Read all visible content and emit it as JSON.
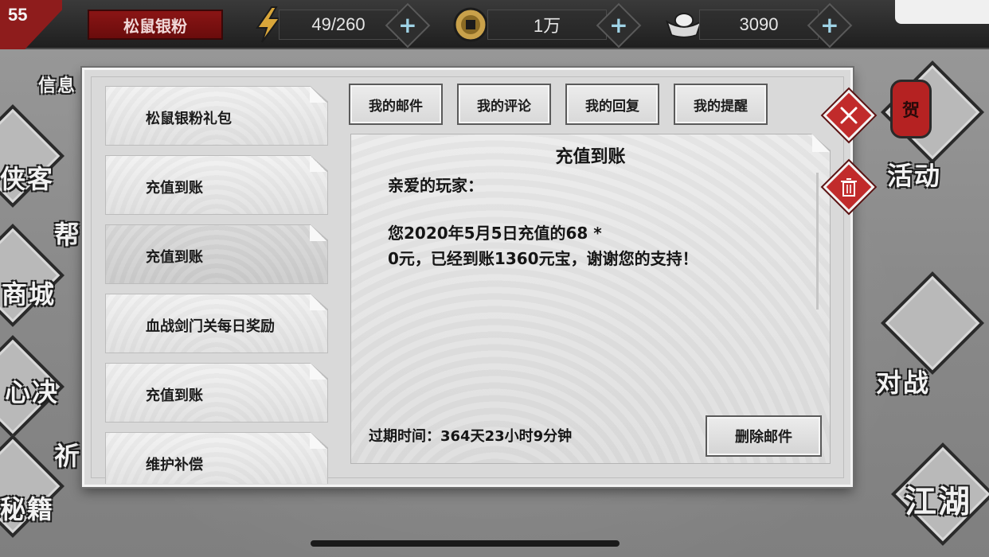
{
  "player": {
    "level": "55",
    "name": "松鼠银粉"
  },
  "resources": {
    "stamina": "49/260",
    "copper": "1万",
    "ingot": "3090"
  },
  "side_menu_left": {
    "xinxi": "信息",
    "xiake": "侠客",
    "bang": "帮",
    "shangcheng": "商城",
    "xinjue": "心决",
    "qi": "祈",
    "miji": "秘籍"
  },
  "side_menu_right": {
    "huodong": "活动",
    "duizhan": "对战",
    "jianghu": "江湖",
    "he": "贺"
  },
  "mail": {
    "list": [
      {
        "label": "松鼠银粉礼包"
      },
      {
        "label": "充值到账"
      },
      {
        "label": "充值到账"
      },
      {
        "label": "血战剑门关每日奖励"
      },
      {
        "label": "充值到账"
      },
      {
        "label": "维护补偿"
      }
    ],
    "tabs": [
      {
        "label": "我的邮件"
      },
      {
        "label": "我的评论"
      },
      {
        "label": "我的回复"
      },
      {
        "label": "我的提醒"
      }
    ],
    "detail": {
      "title": "充值到账",
      "greeting": "亲爱的玩家：",
      "line1": "您2020年5月5日充值的68 *",
      "line2": "0元，已经到账1360元宝，谢谢您的支持！",
      "expire": "过期时间：364天23小时9分钟",
      "delete_label": "删除邮件"
    }
  },
  "colors": {
    "accent_red": "#c12b2b",
    "plus_blue": "#9fd3e6"
  },
  "icons": {
    "stamina": "lightning-icon",
    "copper": "coin-icon",
    "ingot": "ingot-icon",
    "close": "close-icon",
    "delete": "trash-icon"
  }
}
